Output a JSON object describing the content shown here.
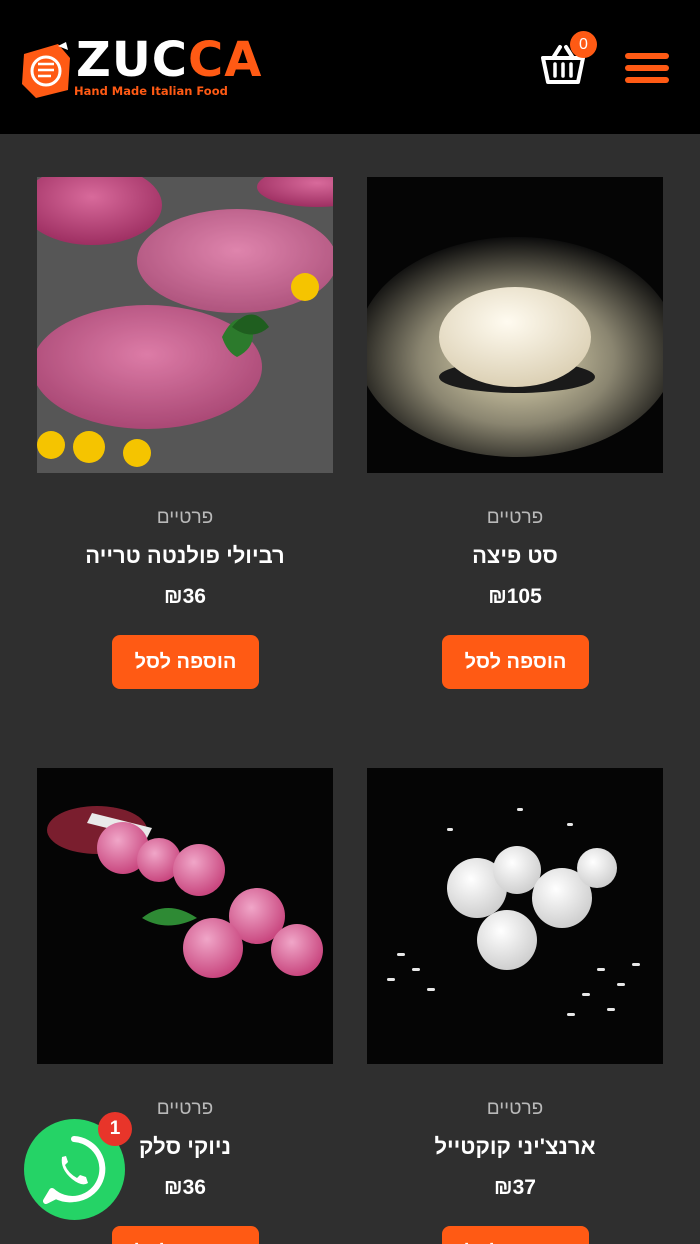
{
  "header": {
    "brand": "ZUCCA",
    "tagline": "Hand Made Italian Food",
    "cart_count": "0",
    "cart_icon": "basket-icon",
    "menu_icon": "hamburger-menu-icon"
  },
  "colors": {
    "accent": "#ff5a14",
    "background": "#2f2f2f",
    "header": "#000000",
    "whatsapp": "#25d366"
  },
  "products": [
    {
      "category": "פרטיים",
      "title": "סט פיצה",
      "price": "₪105",
      "button": "הוספה לסל",
      "image": "pizza-dough-photo"
    },
    {
      "category": "פרטיים",
      "title": "רביולי פולנטה טרייה",
      "price": "₪36",
      "button": "הוספה לסל",
      "image": "ravioli-photo"
    },
    {
      "category": "פרטיים",
      "title": "ארנצ'יני קוקטייל",
      "price": "₪37",
      "button": "הוספה לסל",
      "image": "arancini-photo"
    },
    {
      "category": "פרטיים",
      "title": "ניוקי סלק",
      "price": "₪36",
      "button": "הוספה לסל",
      "image": "beet-gnocchi-photo"
    }
  ],
  "whatsapp": {
    "badge": "1",
    "icon": "whatsapp-icon"
  }
}
